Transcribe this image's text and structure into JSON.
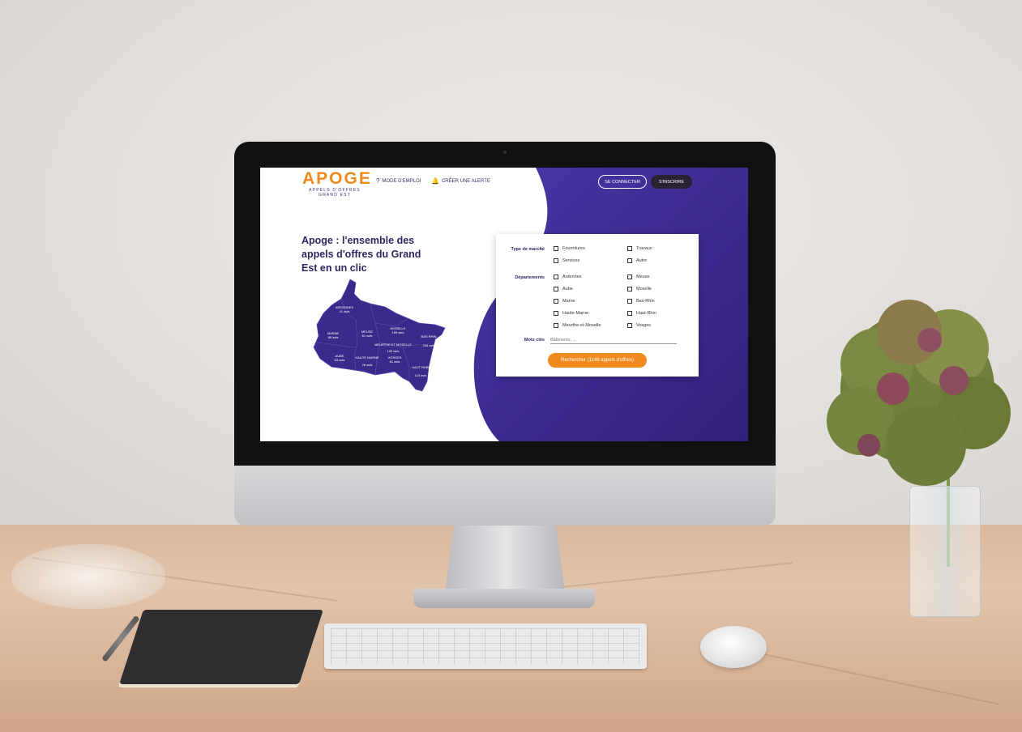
{
  "site": {
    "logo_main": "APOGE",
    "logo_sub_1": "APPELS D'OFFRES",
    "logo_sub_2": "GRAND EST",
    "nav_help": "MODE D'EMPLOI",
    "nav_alert": "CRÉER UNE ALERTE",
    "login_label": "SE CONNECTER",
    "signup_label": "S'INSCRIRE",
    "headline": "Apoge : l'ensemble des appels d'offres du Grand Est en un clic"
  },
  "colors": {
    "purple": "#3d2a8c",
    "orange": "#f08a1c",
    "dark_button": "#2a2234"
  },
  "icons": {
    "help": "question-circle-icon",
    "alert": "bell-icon"
  },
  "map": {
    "regions": [
      {
        "name": "ARDENNES",
        "count": "41 avis"
      },
      {
        "name": "MARNE",
        "count": "88 avis"
      },
      {
        "name": "MEUSE",
        "count": "61 avis"
      },
      {
        "name": "MOSELLE",
        "count": "159 avis"
      },
      {
        "name": "MEURTHE ET MOSELLE",
        "count": "133 avis"
      },
      {
        "name": "BAS RHIN",
        "count": "234 avis"
      },
      {
        "name": "AUBE",
        "count": "63 avis"
      },
      {
        "name": "HAUTE MARNE",
        "count": "26 avis"
      },
      {
        "name": "VOSGES",
        "count": "81 avis"
      },
      {
        "name": "HAUT RHIN",
        "count": "115 avis"
      }
    ]
  },
  "form": {
    "market_type_label": "Type de marché",
    "market_types": [
      "Fournitures",
      "Travaux",
      "Services",
      "Autre"
    ],
    "departments_label": "Départements",
    "departments": [
      "Ardennes",
      "Meuse",
      "Aube",
      "Moselle",
      "Marne",
      "Bas-Rhin",
      "Haute-Marne",
      "Haut-Rhin",
      "Meurthe-et-Moselle",
      "Vosges"
    ],
    "keywords_label": "Mots clés",
    "keywords_placeholder": "Bâtiments, ...",
    "search_button": "Rechercher (1148 appels d'offres)"
  }
}
